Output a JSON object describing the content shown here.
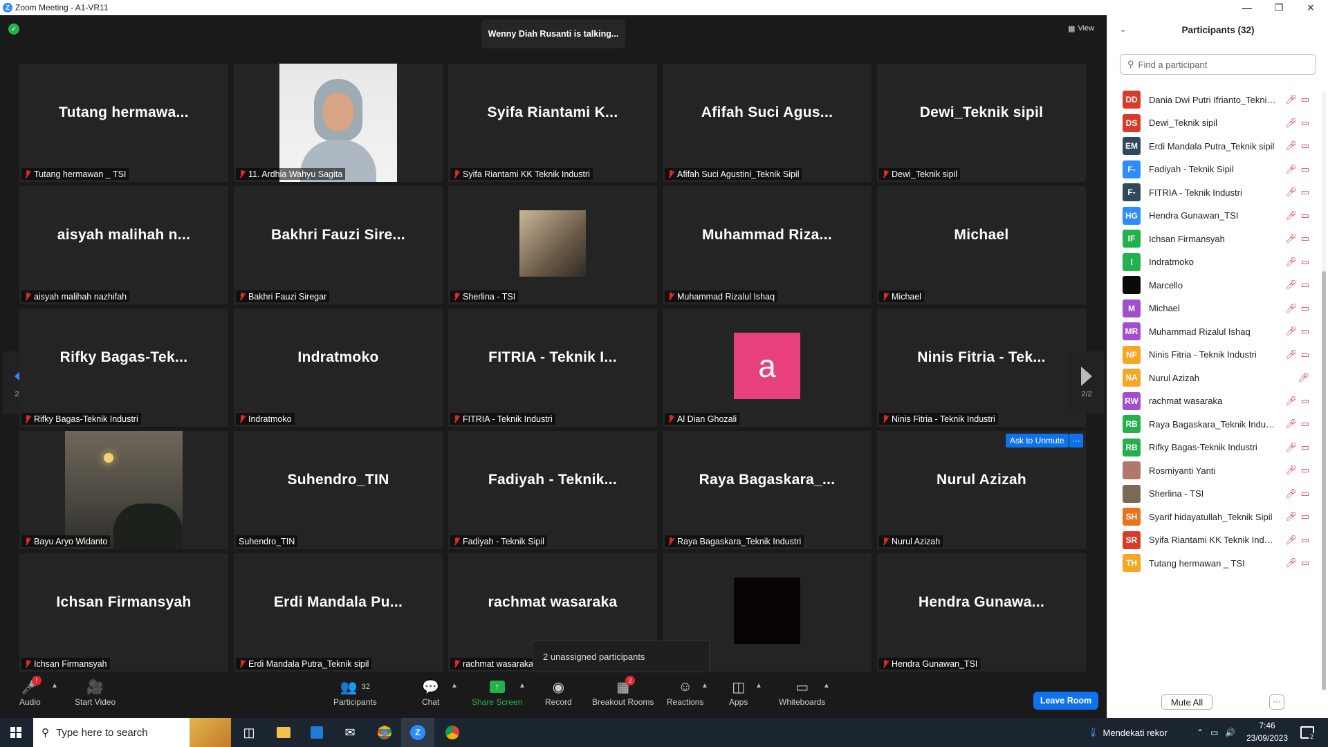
{
  "window": {
    "title": "Zoom Meeting - A1-VR11",
    "logo": "Z"
  },
  "meeting": {
    "talking": "Wenny Diah Rusanti is talking...",
    "view_label": "View",
    "page_indicator": "2/2",
    "ask_to_unmute": "Ask to Unmute",
    "more_dots": "···",
    "unassigned": "2 unassigned participants"
  },
  "tiles": [
    {
      "big": "Tutang  hermawa...",
      "label": "Tutang hermawan _ TSI",
      "muted": true
    },
    {
      "big": "",
      "label": "11. Ardhia Wahyu Sagita",
      "muted": true,
      "media": "photo"
    },
    {
      "big": "Syifa  Riantami  K...",
      "label": "Syifa Riantami KK Teknik Industri",
      "muted": true
    },
    {
      "big": "Afifah  Suci  Agus...",
      "label": "Afifah Suci Agustini_Teknik Sipil",
      "muted": true
    },
    {
      "big": "Dewi_Teknik sipil",
      "label": "Dewi_Teknik sipil",
      "muted": true
    },
    {
      "big": "aisyah  malihah  n...",
      "label": "aisyah malihah nazhifah",
      "muted": true
    },
    {
      "big": "Bakhri  Fauzi  Sire...",
      "label": "Bakhri Fauzi Siregar",
      "muted": true
    },
    {
      "big": "",
      "label": "Sherlina - TSI",
      "muted": true,
      "media": "smallpic"
    },
    {
      "big": "Muhammad  Riza...",
      "label": "Muhammad Rizalul Ishaq",
      "muted": true
    },
    {
      "big": "Michael",
      "label": "Michael",
      "muted": true
    },
    {
      "big": "Rifky  Bagas-Tek...",
      "label": "Rifky Bagas-Teknik Industri",
      "muted": true
    },
    {
      "big": "Indratmoko",
      "label": "Indratmoko",
      "muted": true
    },
    {
      "big": "FITRIA  -  Teknik  I...",
      "label": "FITRIA - Teknik Industri",
      "muted": true
    },
    {
      "big": "",
      "label": "Al Dian Ghozali",
      "muted": true,
      "media": "avatar-a",
      "avatar_letter": "a"
    },
    {
      "big": "Ninis  Fitria  -  Tek...",
      "label": "Ninis Fitria - Teknik Industri",
      "muted": true
    },
    {
      "big": "",
      "label": "Bayu Aryo Widanto",
      "muted": true,
      "media": "sunset"
    },
    {
      "big": "Suhendro_TIN",
      "label": "Suhendro_TIN",
      "muted": false
    },
    {
      "big": "Fadiyah  -  Teknik...",
      "label": "Fadiyah - Teknik Sipil",
      "muted": true
    },
    {
      "big": "Raya  Bagaskara_...",
      "label": "Raya Bagaskara_Teknik Industri",
      "muted": true
    },
    {
      "big": "Nurul Azizah",
      "label": "Nurul Azizah",
      "muted": true
    },
    {
      "big": "Ichsan  Firmansyah",
      "label": "Ichsan Firmansyah",
      "muted": true
    },
    {
      "big": "Erdi  Mandala  Pu...",
      "label": "Erdi Mandala Putra_Teknik sipil",
      "muted": true
    },
    {
      "big": "rachmat  wasaraka",
      "label": "rachmat wasaraka",
      "muted": true
    },
    {
      "big": "",
      "label": "",
      "muted": false,
      "media": "blackbox",
      "tail_glyph": "o"
    },
    {
      "big": "Hendra  Gunawa...",
      "label": "Hendra Gunawan_TSI",
      "muted": true
    }
  ],
  "toolbar": {
    "audio": "Audio",
    "video": "Start Video",
    "participants": "Participants",
    "participants_count": "32",
    "chat": "Chat",
    "share": "Share Screen",
    "record": "Record",
    "breakout": "Breakout Rooms",
    "breakout_badge": "2",
    "reactions": "Reactions",
    "apps": "Apps",
    "whiteboards": "Whiteboards",
    "leave": "Leave Room"
  },
  "panel": {
    "title": "Participants (32)",
    "search_placeholder": "Find a participant",
    "mute_all": "Mute All",
    "more": "···",
    "participants": [
      {
        "initials": "DD",
        "color": "#d93b2b",
        "name": "Dania Dwi Putri Ifrianto_Teknik ...",
        "video_off": true
      },
      {
        "initials": "DS",
        "color": "#d93b2b",
        "name": "Dewi_Teknik sipil",
        "video_off": true
      },
      {
        "initials": "EM",
        "color": "#2f4a5c",
        "name": "Erdi Mandala Putra_Teknik sipil",
        "video_off": true
      },
      {
        "initials": "F-",
        "color": "#2d8cff",
        "name": "Fadiyah - Teknik Sipil",
        "video_off": true
      },
      {
        "initials": "F-",
        "color": "#2f4a5c",
        "name": "FITRIA - Teknik Industri",
        "video_off": true
      },
      {
        "initials": "HG",
        "color": "#2d8cff",
        "name": "Hendra Gunawan_TSI",
        "video_off": true
      },
      {
        "initials": "IF",
        "color": "#23b14d",
        "name": "Ichsan Firmansyah",
        "video_off": true
      },
      {
        "initials": "I",
        "color": "#23b14d",
        "name": "Indratmoko",
        "video_off": true
      },
      {
        "initials": "",
        "color": "#0a0a0a",
        "name": "Marcello",
        "video_off": true
      },
      {
        "initials": "M",
        "color": "#a04fcf",
        "name": "Michael",
        "video_off": true
      },
      {
        "initials": "MR",
        "color": "#a04fcf",
        "name": "Muhammad Rizalul Ishaq",
        "video_off": true
      },
      {
        "initials": "NF",
        "color": "#f5a623",
        "name": "Ninis Fitria - Teknik Industri",
        "video_off": true
      },
      {
        "initials": "NA",
        "color": "#f5a623",
        "name": "Nurul Azizah",
        "video_off": false
      },
      {
        "initials": "RW",
        "color": "#a04fcf",
        "name": "rachmat wasaraka",
        "video_off": true
      },
      {
        "initials": "RB",
        "color": "#23b14d",
        "name": "Raya Bagaskara_Teknik Industri",
        "video_off": true
      },
      {
        "initials": "RB",
        "color": "#23b14d",
        "name": "Rifky Bagas-Teknik Industri",
        "video_off": true
      },
      {
        "initials": "",
        "color": "#b0786a",
        "name": "Rosmiyanti Yanti",
        "video_off": true
      },
      {
        "initials": "",
        "color": "#7a6a55",
        "name": "Sherlina - TSI",
        "video_off": true
      },
      {
        "initials": "SH",
        "color": "#e8731a",
        "name": "Syarif hidayatullah_Teknik Sipil",
        "video_off": true
      },
      {
        "initials": "SR",
        "color": "#d93b2b",
        "name": "Syifa Riantami KK Teknik Industri",
        "video_off": true
      },
      {
        "initials": "TH",
        "color": "#f5a623",
        "name": "Tutang hermawan _ TSI",
        "video_off": true
      }
    ]
  },
  "taskbar": {
    "search_placeholder": "Type here to search",
    "weather": "Mendekati rekor",
    "time": "7:46",
    "date": "23/09/2023",
    "notification_count": "2"
  }
}
